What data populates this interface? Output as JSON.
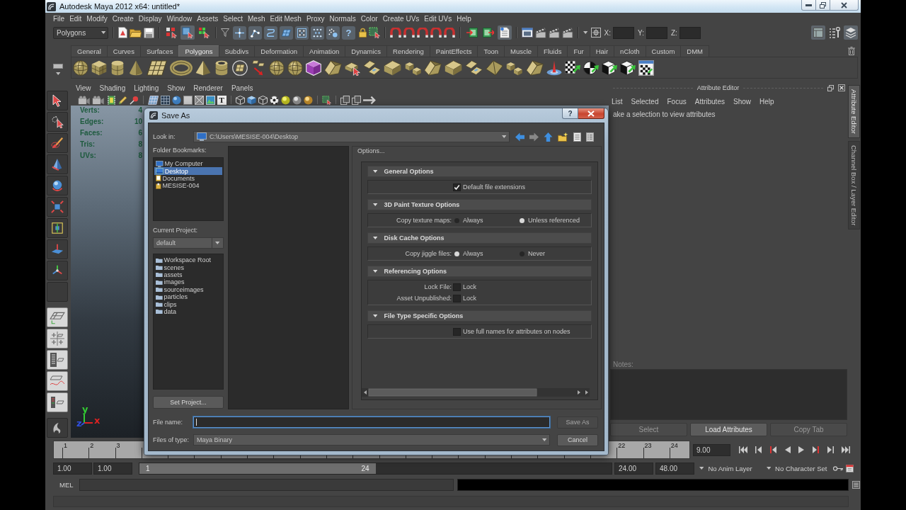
{
  "window": {
    "title": "Autodesk Maya 2012 x64: untitled*"
  },
  "menu_bar": {
    "items": [
      "File",
      "Edit",
      "Modify",
      "Create",
      "Display",
      "Window",
      "Assets",
      "Select",
      "Mesh",
      "Edit Mesh",
      "Proxy",
      "Normals",
      "Color",
      "Create UVs",
      "Edit UVs",
      "Help"
    ]
  },
  "status_line": {
    "menu_set": "Polygons",
    "selection_modes": [
      {
        "selected": false
      },
      {
        "selected": true
      },
      {
        "selected": false
      }
    ],
    "selection_masks": [
      {
        "on": true
      },
      {
        "on": true
      },
      {
        "on": true
      },
      {
        "on": true
      },
      {
        "on": true
      },
      {
        "on": true
      },
      {
        "on": true
      }
    ],
    "help_button": "?",
    "io_toggles": [
      {
        "on": false
      },
      {
        "on": false
      },
      {
        "on": true
      }
    ],
    "coordinates": [
      "X:",
      "Y:",
      "Z:"
    ],
    "panel_toggles": [
      {
        "on": true
      },
      {
        "on": false
      },
      {
        "on": true
      }
    ]
  },
  "shelf": {
    "tabs": [
      {
        "label": "General",
        "selected": false
      },
      {
        "label": "Curves",
        "selected": false
      },
      {
        "label": "Surfaces",
        "selected": false
      },
      {
        "label": "Polygons",
        "selected": true
      },
      {
        "label": "Subdivs",
        "selected": false
      },
      {
        "label": "Deformation",
        "selected": false
      },
      {
        "label": "Animation",
        "selected": false
      },
      {
        "label": "Dynamics",
        "selected": false
      },
      {
        "label": "Rendering",
        "selected": false
      },
      {
        "label": "PaintEffects",
        "selected": false
      },
      {
        "label": "Toon",
        "selected": false
      },
      {
        "label": "Muscle",
        "selected": false
      },
      {
        "label": "Fluids",
        "selected": false
      },
      {
        "label": "Fur",
        "selected": false
      },
      {
        "label": "Hair",
        "selected": false
      },
      {
        "label": "nCloth",
        "selected": false
      },
      {
        "label": "Custom",
        "selected": false
      },
      {
        "label": "DMM",
        "selected": false
      }
    ]
  },
  "viewport": {
    "menus": [
      "View",
      "Shading",
      "Lighting",
      "Show",
      "Renderer",
      "Panels"
    ],
    "text_toggle": "T",
    "hud": [
      {
        "label": "Verts:",
        "value": "4"
      },
      {
        "label": "Edges:",
        "value": "10"
      },
      {
        "label": "Faces:",
        "value": "6"
      },
      {
        "label": "Tris:",
        "value": "8"
      },
      {
        "label": "UVs:",
        "value": "8"
      }
    ],
    "axes": [
      {
        "label": "y",
        "color": "#33cc33"
      },
      {
        "label": "x",
        "color": "#dd2222"
      },
      {
        "label": "z",
        "color": "#2f4fe0"
      }
    ]
  },
  "save_as_dialog": {
    "title": "Save As",
    "help_button": "?",
    "look_in": {
      "label": "Look in:",
      "path": "C:\\Users\\MESISE-004\\Desktop"
    },
    "bookmarks": {
      "label": "Folder Bookmarks:",
      "items": [
        {
          "label": "My Computer",
          "kind": "computer",
          "selected": false
        },
        {
          "label": "Desktop",
          "kind": "desktop",
          "selected": true
        },
        {
          "label": "Documents",
          "kind": "documents",
          "selected": false
        },
        {
          "label": "MESISE-004",
          "kind": "user",
          "selected": false
        }
      ]
    },
    "current_project": {
      "label": "Current Project:",
      "value": "default"
    },
    "project_folders": [
      "Workspace Root",
      "scenes",
      "assets",
      "images",
      "sourceimages",
      "particles",
      "clips",
      "data"
    ],
    "set_project_button": "Set Project...",
    "options": {
      "title": "Options...",
      "sections": [
        {
          "title": "General Options",
          "expanded": true,
          "rows": [
            {
              "kind": "checkbox",
              "text": "Default file extensions",
              "checked": true
            }
          ]
        },
        {
          "title": "3D Paint Texture Options",
          "expanded": true,
          "rows": [
            {
              "kind": "radio",
              "label": "Copy texture maps:",
              "choices": [
                {
                  "text": "Always",
                  "selected": false
                },
                {
                  "text": "Unless referenced",
                  "selected": true
                }
              ]
            }
          ]
        },
        {
          "title": "Disk Cache Options",
          "expanded": true,
          "rows": [
            {
              "kind": "radio",
              "label": "Copy jiggle files:",
              "choices": [
                {
                  "text": "Always",
                  "selected": true
                },
                {
                  "text": "Never",
                  "selected": false
                }
              ]
            }
          ]
        },
        {
          "title": "Referencing Options",
          "expanded": true,
          "rows": [
            {
              "kind": "checkbox",
              "label": "Lock File:",
              "text": "Lock",
              "checked": false
            },
            {
              "kind": "checkbox",
              "label": "Asset Unpublished:",
              "text": "Lock",
              "checked": false
            }
          ]
        },
        {
          "title": "File Type Specific Options",
          "expanded": true,
          "rows": [
            {
              "kind": "checkbox",
              "text": "Use full names for attributes on nodes",
              "checked": false
            }
          ]
        }
      ]
    },
    "file_name": {
      "label": "File name:",
      "focused": true
    },
    "file_type": {
      "label": "Files of type:",
      "value": "Maya Binary"
    },
    "buttons": [
      {
        "label": "Save As",
        "disabled": true
      },
      {
        "label": "Cancel",
        "disabled": false
      }
    ]
  },
  "attribute_editor": {
    "title": "Attribute Editor",
    "menus": [
      "List",
      "Selected",
      "Focus",
      "Attributes",
      "Show",
      "Help"
    ],
    "message": "ake a selection to view attributes",
    "notes_label": "Notes:",
    "buttons": [
      {
        "label": "Select",
        "disabled": true
      },
      {
        "label": "Load Attributes",
        "disabled": false
      },
      {
        "label": "Copy Tab",
        "disabled": true
      }
    ]
  },
  "side_tabs": [
    {
      "label": "Attribute Editor",
      "selected": true
    },
    {
      "label": "Channel Box / Layer Editor",
      "selected": false
    }
  ],
  "time_slider": {
    "ruler_start": [
      "1",
      "2",
      "3"
    ],
    "ruler_end": [
      "22",
      "23",
      "24"
    ],
    "current_time": "9.00"
  },
  "range_slider": {
    "start_time": "1.00",
    "playback_start": "1.00",
    "range_start": "1",
    "range_end": "24",
    "level": 0.5,
    "playback_end": "24.00",
    "end_time": "48.00",
    "anim_layer": "No Anim Layer",
    "character_set": "No Character Set"
  },
  "command_line": {
    "language": "MEL"
  }
}
